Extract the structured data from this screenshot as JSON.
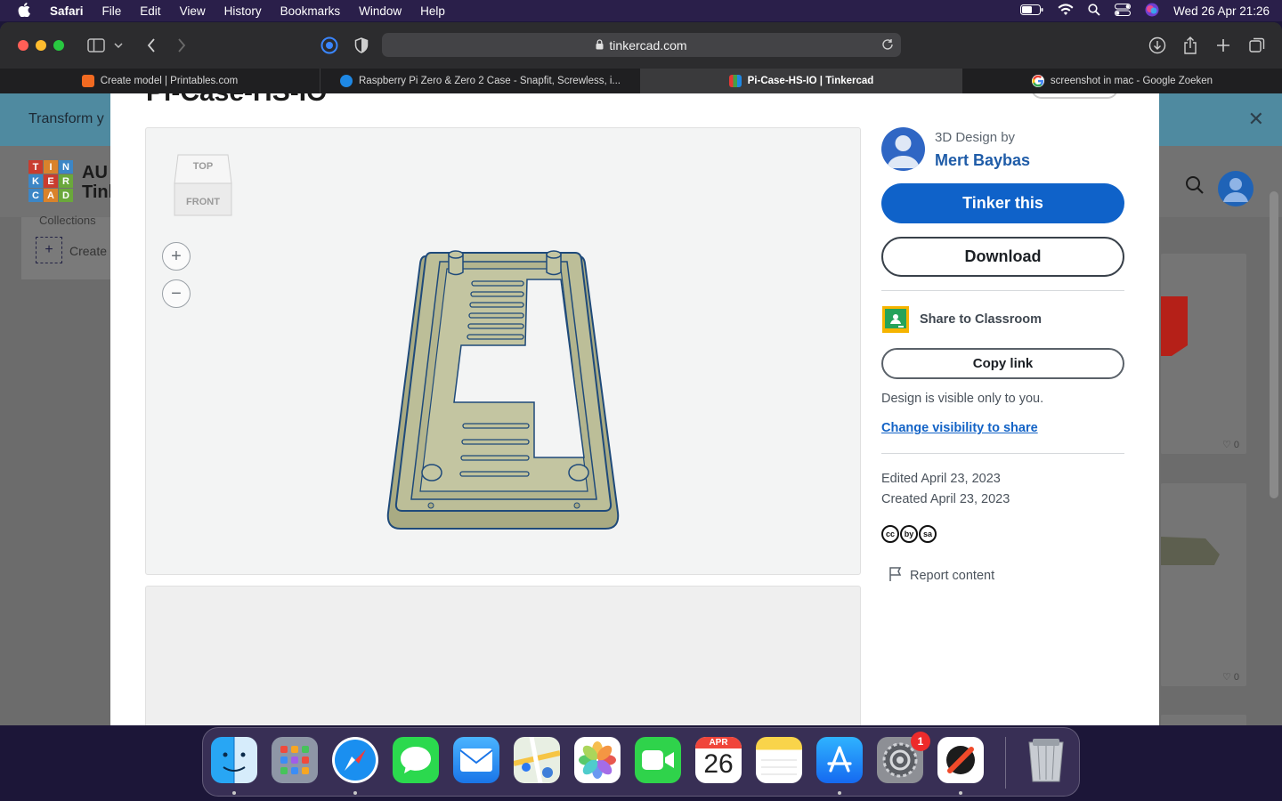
{
  "menubar": {
    "app": "Safari",
    "items": [
      "File",
      "Edit",
      "View",
      "History",
      "Bookmarks",
      "Window",
      "Help"
    ],
    "datetime": "Wed 26 Apr  21:26"
  },
  "browser": {
    "url": "tinkercad.com",
    "tabs": [
      {
        "label": "Create model | Printables.com",
        "favicon_color": "#f26a21",
        "active": false
      },
      {
        "label": "Raspberry Pi Zero & Zero 2 Case - Snapfit, Screwless, i...",
        "favicon_color": "#1e88e5",
        "active": false
      },
      {
        "label": "Pi-Case-HS-IO | Tinkercad",
        "favicon_color": "#e53935",
        "active": true
      },
      {
        "label": "screenshot in mac - Google Zoeken",
        "favicon_color": "#ffffff",
        "active": false
      }
    ]
  },
  "background_page": {
    "banner_text": "Transform y",
    "logo_letters": [
      "T",
      "I",
      "N",
      "K",
      "E",
      "R",
      "C",
      "A",
      "D"
    ],
    "brand_fragment_1": "AU",
    "brand_fragment_2": "Tinl",
    "collections_label": "Collections",
    "create_label": "Create",
    "like_counts": [
      "♡ 0",
      "♡ 0"
    ]
  },
  "modal": {
    "title_fragment": "Pi-Case-HS-IO",
    "viewcube": {
      "top": "TOP",
      "front": "FRONT"
    },
    "zoom_in": "+",
    "zoom_out": "−",
    "design_by_label": "3D Design by",
    "author": "Mert Baybas",
    "tinker_button": "Tinker this",
    "download_button": "Download",
    "share_classroom": "Share to Classroom",
    "copy_link": "Copy link",
    "visibility_text": "Design is visible only to you.",
    "visibility_link": "Change visibility to share",
    "edited": "Edited April 23, 2023",
    "created": "Created April 23, 2023",
    "license_icons": [
      "cc",
      "by",
      "sa"
    ],
    "report": "Report content"
  },
  "dock": {
    "apps": [
      "Finder",
      "Launchpad",
      "Safari",
      "Messages",
      "Mail",
      "Maps",
      "Photos",
      "FaceTime",
      "Calendar",
      "Notes",
      "App Store",
      "System Settings",
      "Pocket",
      "Trash"
    ],
    "calendar_month": "APR",
    "calendar_day": "26",
    "settings_badge": "1"
  },
  "colors": {
    "accent_blue": "#0f62c9",
    "link_blue": "#1363c6",
    "model_fill": "#b6b890",
    "model_edge": "#1f4a7a"
  }
}
